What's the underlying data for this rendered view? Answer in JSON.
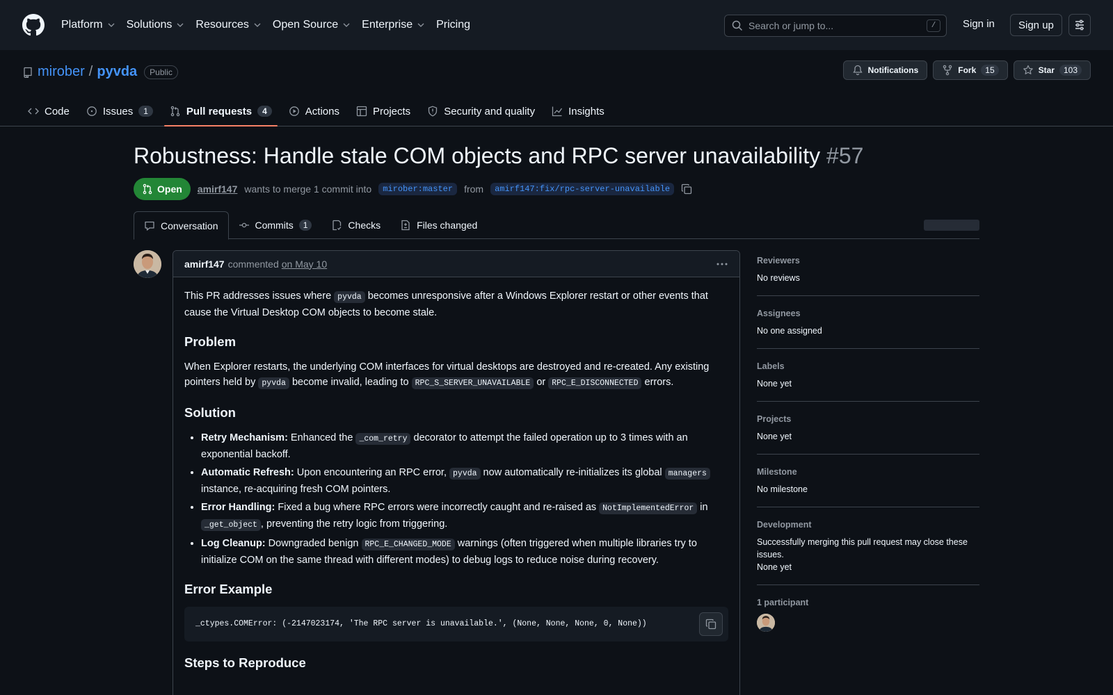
{
  "nav": {
    "items": [
      {
        "label": "Platform",
        "dropdown": true
      },
      {
        "label": "Solutions",
        "dropdown": true
      },
      {
        "label": "Resources",
        "dropdown": true
      },
      {
        "label": "Open Source",
        "dropdown": true
      },
      {
        "label": "Enterprise",
        "dropdown": true
      },
      {
        "label": "Pricing",
        "dropdown": false
      }
    ],
    "search_placeholder": "Search or jump to...",
    "search_shortcut": "/",
    "sign_in": "Sign in",
    "sign_up": "Sign up"
  },
  "repo": {
    "owner": "mirober",
    "separator": "/",
    "name": "pyvda",
    "visibility": "Public",
    "notifications_label": "Notifications",
    "fork_label": "Fork",
    "fork_count": "15",
    "star_label": "Star",
    "star_count": "103",
    "tabs": [
      {
        "label": "Code",
        "count": "",
        "icon": "code-icon"
      },
      {
        "label": "Issues",
        "count": "1",
        "icon": "issue-icon"
      },
      {
        "label": "Pull requests",
        "count": "4",
        "icon": "pull-request-icon",
        "active": true
      },
      {
        "label": "Actions",
        "count": "",
        "icon": "play-icon"
      },
      {
        "label": "Projects",
        "count": "",
        "icon": "table-icon"
      },
      {
        "label": "Security and quality",
        "count": "",
        "icon": "shield-icon"
      },
      {
        "label": "Insights",
        "count": "",
        "icon": "graph-icon"
      }
    ]
  },
  "pr": {
    "title": "Robustness: Handle stale COM objects and RPC server unavailability",
    "number": "#57",
    "status": "Open",
    "author": "amirf147",
    "merge_text_1": "wants to merge 1 commit into",
    "base_branch": "mirober:master",
    "merge_text_2": "from",
    "head_branch": "amirf147:fix/rpc-server-unavailable",
    "tabs": {
      "conversation": "Conversation",
      "commits": "Commits",
      "commits_count": "1",
      "checks": "Checks",
      "files_changed": "Files changed"
    }
  },
  "comment": {
    "author": "amirf147",
    "action": "commented",
    "date": "on May 10",
    "intro_1": "This PR addresses issues where ",
    "intro_code": "pyvda",
    "intro_2": " becomes unresponsive after a Windows Explorer restart or other events that cause the Virtual Desktop COM objects to become stale.",
    "problem_heading": "Problem",
    "problem_1": "When Explorer restarts, the underlying COM interfaces for virtual desktops are destroyed and re-created. Any existing pointers held by ",
    "problem_code_1": "pyvda",
    "problem_2": " become invalid, leading to ",
    "problem_code_2": "RPC_S_SERVER_UNAVAILABLE",
    "problem_3": " or ",
    "problem_code_3": "RPC_E_DISCONNECTED",
    "problem_4": " errors.",
    "solution_heading": "Solution",
    "solution": {
      "b1_title": "Retry Mechanism:",
      "b1_text_1": " Enhanced the ",
      "b1_code": "_com_retry",
      "b1_text_2": " decorator to attempt the failed operation up to 3 times with an exponential backoff.",
      "b2_title": "Automatic Refresh:",
      "b2_text_1": " Upon encountering an RPC error, ",
      "b2_code_1": "pyvda",
      "b2_text_2": " now automatically re-initializes its global ",
      "b2_code_2": "managers",
      "b2_text_3": " instance, re-acquiring fresh COM pointers.",
      "b3_title": "Error Handling:",
      "b3_text_1": " Fixed a bug where RPC errors were incorrectly caught and re-raised as ",
      "b3_code_1": "NotImplementedError",
      "b3_text_2": " in ",
      "b3_code_2": "_get_object",
      "b3_text_3": ", preventing the retry logic from triggering.",
      "b4_title": "Log Cleanup:",
      "b4_text_1": " Downgraded benign ",
      "b4_code": "RPC_E_CHANGED_MODE",
      "b4_text_2": " warnings (often triggered when multiple libraries try to initialize COM on the same thread with different modes) to debug logs to reduce noise during recovery."
    },
    "error_heading": "Error Example",
    "error_code": "_ctypes.COMError: (-2147023174, 'The RPC server is unavailable.', (None, None, None, 0, None))",
    "steps_heading": "Steps to Reproduce"
  },
  "sidebar": {
    "reviewers_label": "Reviewers",
    "reviewers_value": "No reviews",
    "assignees_label": "Assignees",
    "assignees_value": "No one assigned",
    "labels_label": "Labels",
    "labels_value": "None yet",
    "projects_label": "Projects",
    "projects_value": "None yet",
    "milestone_label": "Milestone",
    "milestone_value": "No milestone",
    "development_label": "Development",
    "development_text": "Successfully merging this pull request may close these issues.",
    "development_value": "None yet",
    "participants_label": "1 participant"
  },
  "colors": {
    "background": "#0d1117",
    "header": "#151b23",
    "accent_link": "#4493f8",
    "open_green": "#238636",
    "active_tab_underline": "#f78166",
    "border": "#3d444d"
  }
}
